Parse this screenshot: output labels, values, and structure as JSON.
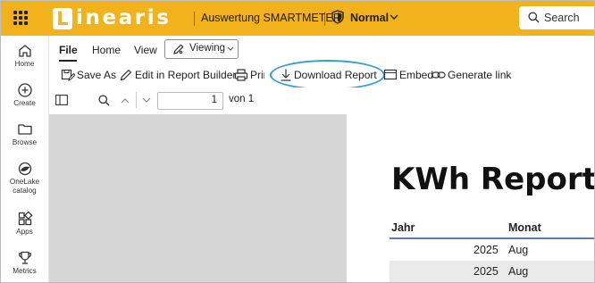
{
  "brand": {
    "logo_letter": "L",
    "logo_rest": "inearis"
  },
  "report": {
    "name": "Auswertung SMARTMETER"
  },
  "sensitivity": {
    "label": "Normal"
  },
  "search": {
    "placeholder": "Search"
  },
  "nav": [
    {
      "label": "Home",
      "icon": "home-icon"
    },
    {
      "label": "Create",
      "icon": "plus-circle-icon"
    },
    {
      "label": "Browse",
      "icon": "folder-icon"
    },
    {
      "label": "OneLake",
      "label2": "catalog",
      "icon": "onelake-icon"
    },
    {
      "label": "Apps",
      "icon": "apps-icon"
    },
    {
      "label": "Metrics",
      "icon": "trophy-icon"
    }
  ],
  "ribbon": {
    "tabs": [
      "File",
      "Home",
      "View"
    ],
    "viewing_label": "Viewing",
    "commands": {
      "save_as": "Save As",
      "edit": "Edit in Report Builder",
      "print": "Print",
      "download": "Download Report",
      "embed": "Embed",
      "link": "Generate link"
    }
  },
  "paging": {
    "current": "1",
    "of_label": "von 1"
  },
  "report_page": {
    "title": "KWh Report",
    "columns": [
      "Jahr",
      "Monat"
    ],
    "rows": [
      {
        "jahr": "2025",
        "monat": "Aug"
      },
      {
        "jahr": "2025",
        "monat": "Aug"
      }
    ]
  },
  "colors": {
    "topbar": "#f2b21b",
    "highlight": "#2f9de0",
    "table_rule": "#5a7fb0"
  }
}
